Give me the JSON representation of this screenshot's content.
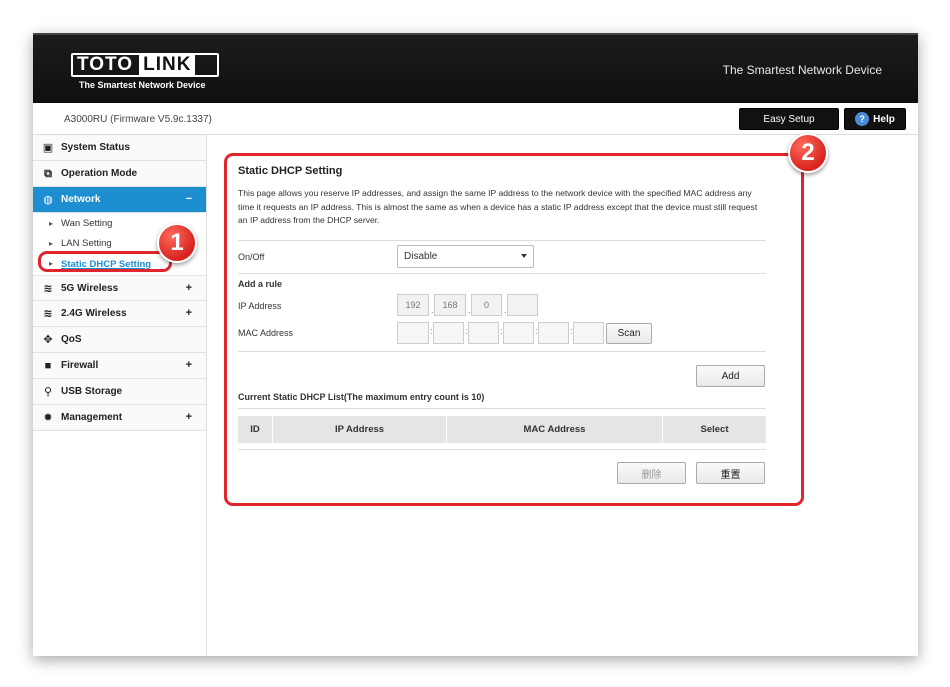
{
  "header": {
    "logo_left": "TOTO",
    "logo_right": "LINK",
    "logo_sub": "The Smartest Network Device",
    "tagline": "The Smartest Network Device"
  },
  "subbar": {
    "firmware": "A3000RU (Firmware V5.9c.1337)",
    "easy_setup": "Easy Setup",
    "help": "Help"
  },
  "sidebar": {
    "items": [
      {
        "label": "System Status",
        "icon": "monitor-icon",
        "glyph": "▣",
        "toggle": ""
      },
      {
        "label": "Operation Mode",
        "icon": "windows-icon",
        "glyph": "⧉",
        "toggle": ""
      },
      {
        "label": "Network",
        "icon": "globe-icon",
        "glyph": "◍",
        "toggle": "−"
      },
      {
        "label": "5G Wireless",
        "icon": "wifi-icon",
        "glyph": "≋",
        "toggle": "+"
      },
      {
        "label": "2.4G Wireless",
        "icon": "wifi-icon",
        "glyph": "≋",
        "toggle": "+"
      },
      {
        "label": "QoS",
        "icon": "qos-icon",
        "glyph": "✥",
        "toggle": ""
      },
      {
        "label": "Firewall",
        "icon": "lock-icon",
        "glyph": "■",
        "toggle": "+"
      },
      {
        "label": "USB Storage",
        "icon": "usb-icon",
        "glyph": "⚲",
        "toggle": ""
      },
      {
        "label": "Management",
        "icon": "gear-icon",
        "glyph": "✹",
        "toggle": "+"
      }
    ],
    "network_sub": [
      {
        "label": "Wan Setting"
      },
      {
        "label": "LAN Setting"
      },
      {
        "label": "Static DHCP Setting"
      }
    ]
  },
  "callouts": {
    "one": "1",
    "two": "2"
  },
  "main": {
    "title": "Static DHCP Setting",
    "description": "This page allows you reserve IP addresses, and assign the same IP address to the network device with the specified MAC address any time it requests an IP address. This is almost the same as when a device has a static IP address except that the device must still request an IP address from the DHCP server.",
    "onoff_label": "On/Off",
    "onoff_value": "Disable",
    "add_rule": "Add a rule",
    "ip_label": "IP Address",
    "ip_octets": [
      "192",
      "168",
      "0",
      ""
    ],
    "mac_label": "MAC Address",
    "mac_parts": [
      "",
      "",
      "",
      "",
      "",
      ""
    ],
    "scan": "Scan",
    "add": "Add",
    "list_title": "Current Static DHCP List(The maximum entry count is 10)",
    "columns": [
      "ID",
      "IP Address",
      "MAC Address",
      "Select"
    ],
    "delete": "删除",
    "reset": "重置"
  },
  "colors": {
    "accent": "#1d8fd0",
    "callout": "#e0262b",
    "header": "#111111"
  }
}
